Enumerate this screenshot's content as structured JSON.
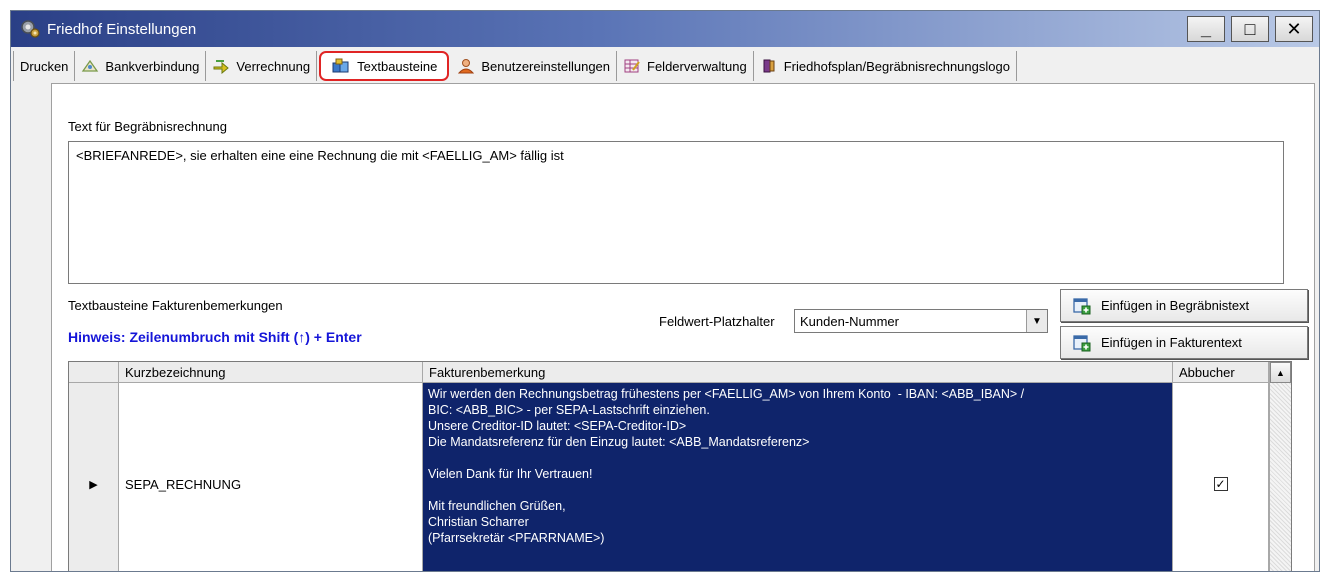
{
  "window": {
    "title": "Friedhof Einstellungen",
    "minimize": "_",
    "maximize": "□",
    "close": "✕"
  },
  "tabs": [
    {
      "label": "Drucken",
      "icon": "none"
    },
    {
      "label": "Bankverbindung",
      "icon": "bank-icon"
    },
    {
      "label": "Verrechnung",
      "icon": "arrow-icon"
    },
    {
      "label": "Textbausteine",
      "icon": "blocks-icon",
      "active": true
    },
    {
      "label": "Benutzereinstellungen",
      "icon": "user-icon"
    },
    {
      "label": "Felderverwaltung",
      "icon": "fields-icon"
    },
    {
      "label": "Friedhofsplan/Begräbnisrechnungslogo",
      "icon": "plan-icon"
    }
  ],
  "main": {
    "burial_text_label": "Text für Begräbnisrechnung",
    "burial_text_value": "<BRIEFANREDE>, sie erhalten eine eine Rechnung die mit <FAELLIG_AM> fällig ist",
    "invoice_blocks_label": "Textbausteine Fakturenbemerkungen",
    "hint": "Hinweis: Zeilenumbruch mit Shift (↑) + Enter",
    "placeholder_label": "Feldwert-Platzhalter",
    "placeholder_value": "Kunden-Nummer",
    "insert_burial_button": "Einfügen in Begräbnistext",
    "insert_invoice_button": "Einfügen in Fakturentext"
  },
  "grid": {
    "columns": [
      "Kurzbezeichnung",
      "Fakturenbemerkung",
      "Abbucher"
    ],
    "rows": [
      {
        "selector": "▶",
        "kurz": "SEPA_RECHNUNG",
        "text": "Wir werden den Rechnungsbetrag frühestens per <FAELLIG_AM> von Ihrem Konto  - IBAN: <ABB_IBAN> /\nBIC: <ABB_BIC> - per SEPA-Lastschrift einziehen.\nUnsere Creditor-ID lautet: <SEPA-Creditor-ID>\nDie Mandatsreferenz für den Einzug lautet: <ABB_Mandatsreferenz>\n\nVielen Dank für Ihr Vertrauen!\n\nMit freundlichen Grüßen,\nChristian Scharrer\n(Pfarrsekretär <PFARRNAME>)",
        "abbucher_checked": "✓"
      }
    ]
  },
  "colors": {
    "active_tab_highlight": "#e02424",
    "hint_text": "#1515d8",
    "selected_cell": "#0f246b"
  }
}
